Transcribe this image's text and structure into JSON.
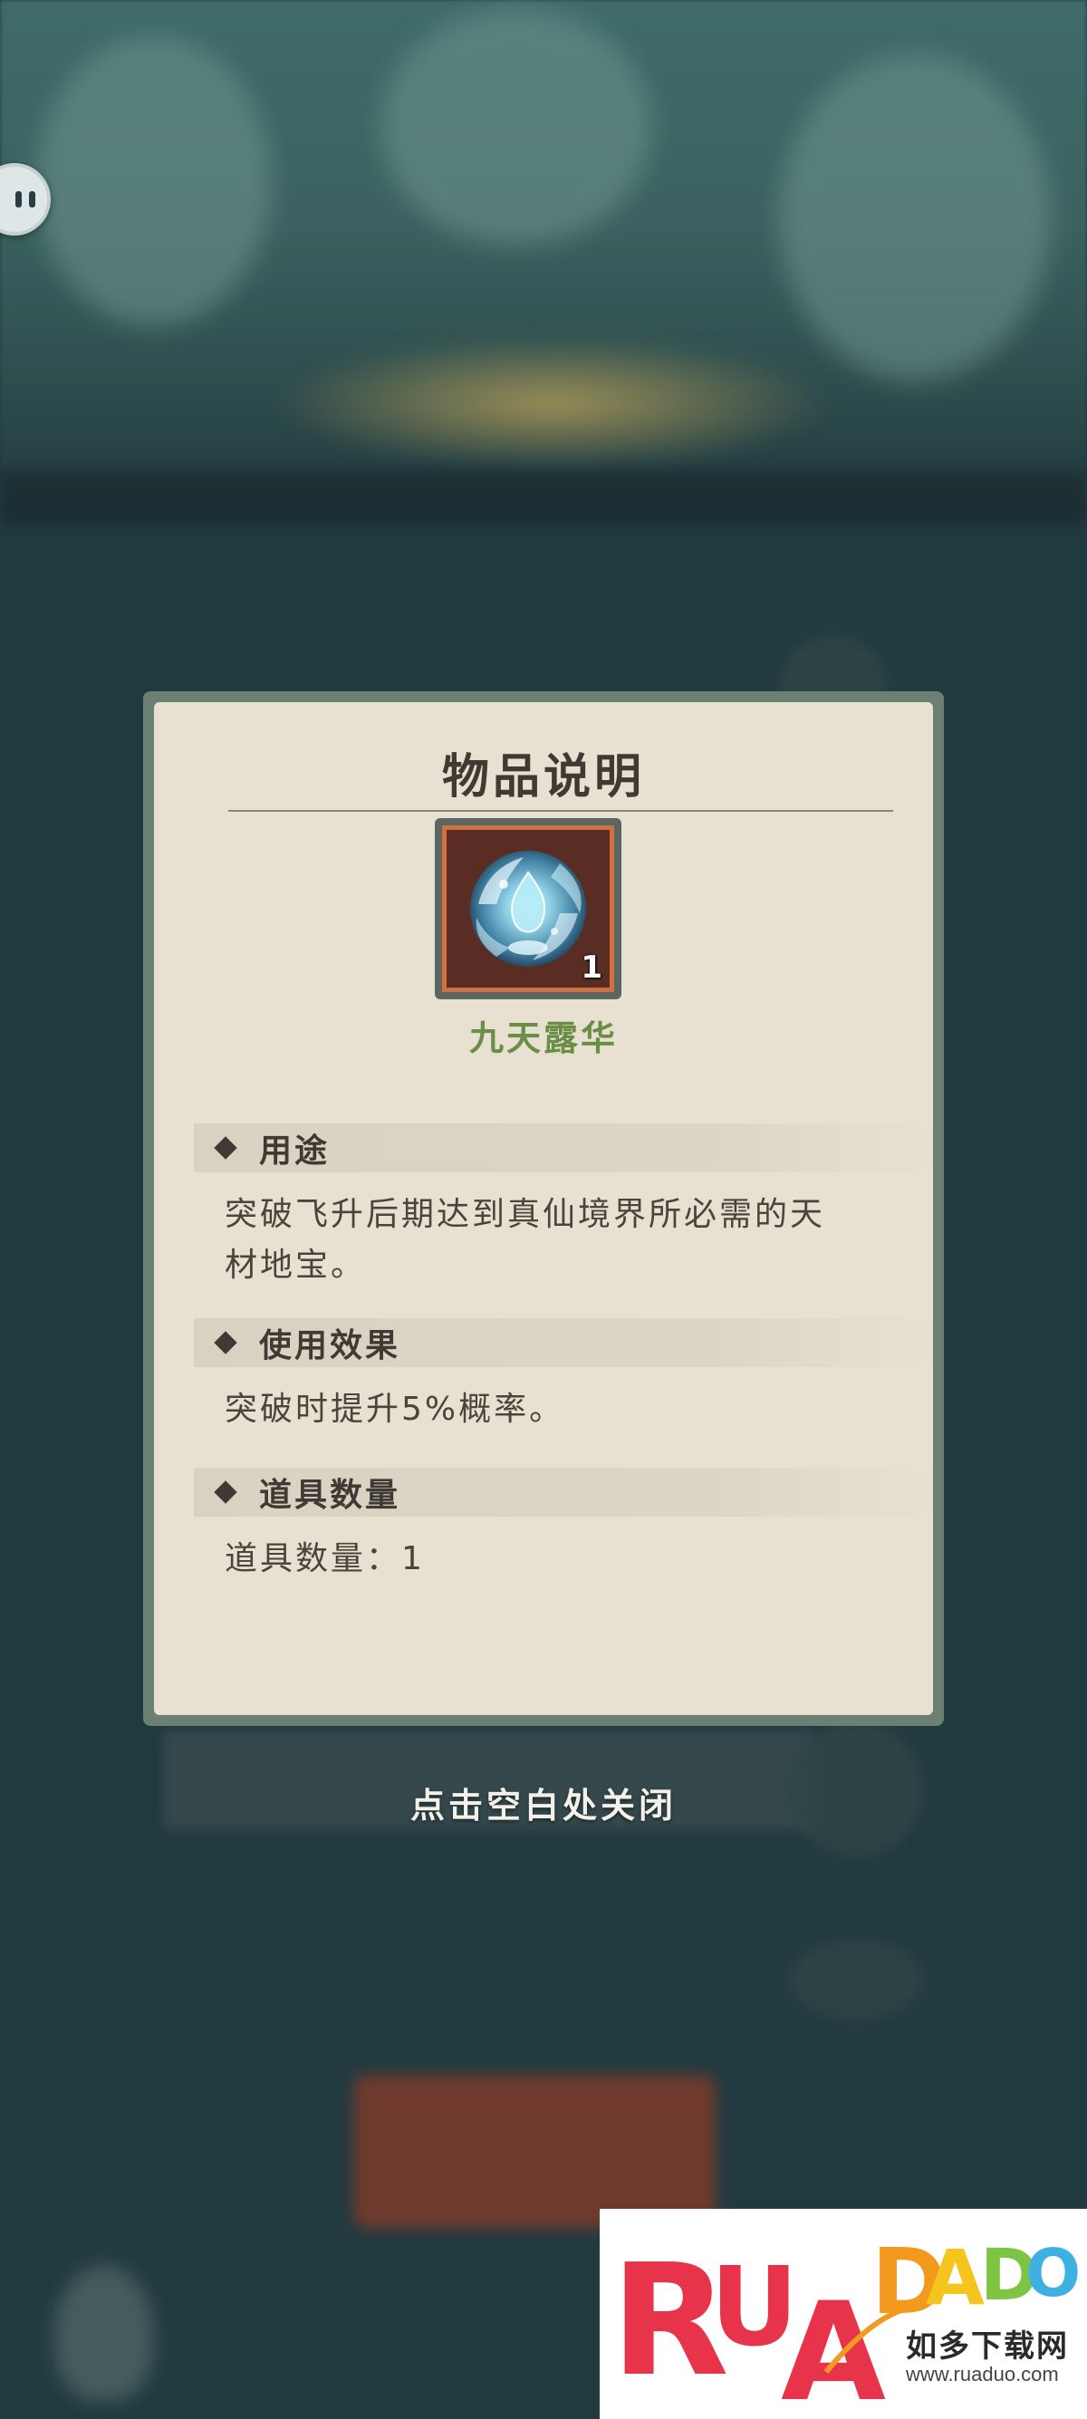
{
  "modal": {
    "title": "物品说明",
    "item": {
      "name": "九天露华",
      "count": "1",
      "icon": "dew-orb-icon"
    },
    "sections": [
      {
        "label": "用途",
        "body": "突破飞升后期达到真仙境界所必需的天材地宝。"
      },
      {
        "label": "使用效果",
        "body": "突破时提升5%概率。"
      },
      {
        "label": "道具数量",
        "body": "道具数量：1"
      }
    ]
  },
  "close_hint": "点击空白处关闭",
  "watermark": {
    "logo_text": "RUADADO",
    "cn_text": "如多下载网",
    "url": "www.ruaduo.com"
  },
  "colors": {
    "modal_bg": "#e8e0d1",
    "modal_frame": "#6b8072",
    "item_name": "#6a8e46",
    "slot_border": "#d2703e",
    "background": "#213a40"
  }
}
